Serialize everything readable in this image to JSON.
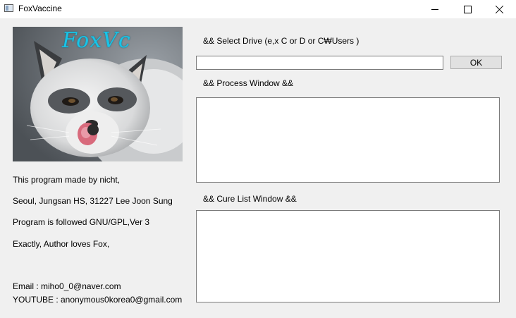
{
  "window": {
    "title": "FoxVaccine",
    "icon": "app-window-icon",
    "controls": [
      "minimize-icon",
      "maximize-icon",
      "close-icon"
    ]
  },
  "image": {
    "description_icon": "fox-photo",
    "logo_text": "FoxVc"
  },
  "info": {
    "line1": "This program made by nicht,",
    "line2": "Seoul, Jungsan HS, 31227 Lee Joon Sung",
    "line3": "Program is followed GNU/GPL,Ver 3",
    "line4": "Exactly, Author loves Fox,",
    "email": "Email : miho0_0@naver.com",
    "youtube": "YOUTUBE : anonymous0korea0@gmail.com"
  },
  "drive": {
    "label": "&& Select Drive (e,x C or D or C₩Users )",
    "input_value": "",
    "ok_label": "OK"
  },
  "process": {
    "label": "&& Process Window &&",
    "content": ""
  },
  "cure": {
    "label": "&& Cure List Window &&",
    "content": ""
  }
}
